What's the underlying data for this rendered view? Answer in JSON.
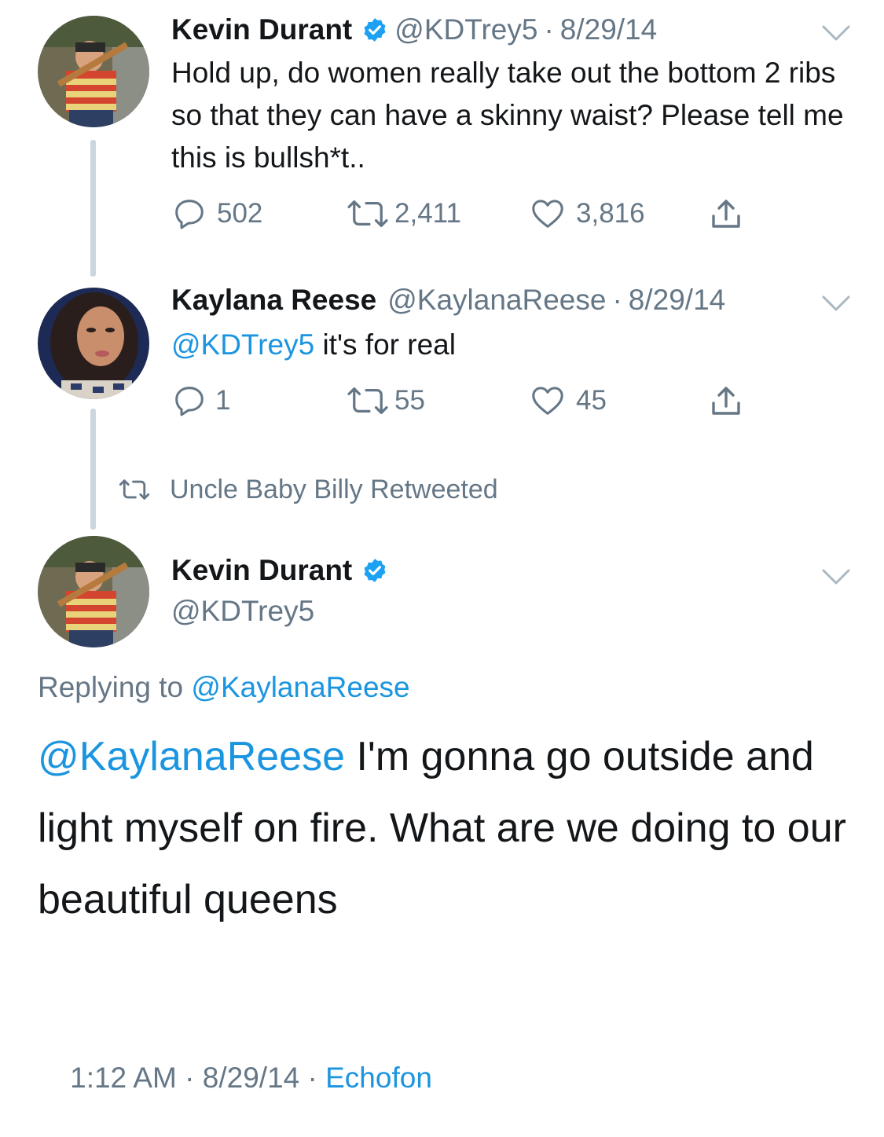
{
  "tweets": [
    {
      "name": "Kevin Durant",
      "handle": "@KDTrey5",
      "sep": "·",
      "date": "8/29/14",
      "text": "Hold up, do women really take out the bottom 2 ribs so that they can have a skinny waist? Please tell me this is bullsh*t..",
      "replies": "502",
      "retweets": "2,411",
      "likes": "3,816"
    },
    {
      "name": "Kaylana Reese",
      "handle": "@KaylanaReese",
      "sep": "·",
      "date": "8/29/14",
      "mention": "@KDTrey5",
      "text": " it's for real",
      "replies": "1",
      "retweets": "55",
      "likes": "45"
    }
  ],
  "retweet_context": "Uncle Baby Billy Retweeted",
  "main": {
    "name": "Kevin Durant",
    "handle": "@KDTrey5",
    "replying_prefix": "Replying to ",
    "replying_to": "@KaylanaReese",
    "mention": "@KaylanaReese",
    "text": " I'm gonna go outside and light myself on fire. What are we doing to our beautiful queens",
    "time": "1:12 AM",
    "sep1": " · ",
    "date": "8/29/14",
    "sep2": " · ",
    "source": "Echofon"
  },
  "colors": {
    "link": "#1b95e0",
    "muted": "#657786",
    "text": "#14171a",
    "thread": "#ccd6dd"
  },
  "icons": [
    "reply-icon",
    "retweet-icon",
    "like-icon",
    "share-icon",
    "verified-badge-icon",
    "chevron-down-icon"
  ]
}
